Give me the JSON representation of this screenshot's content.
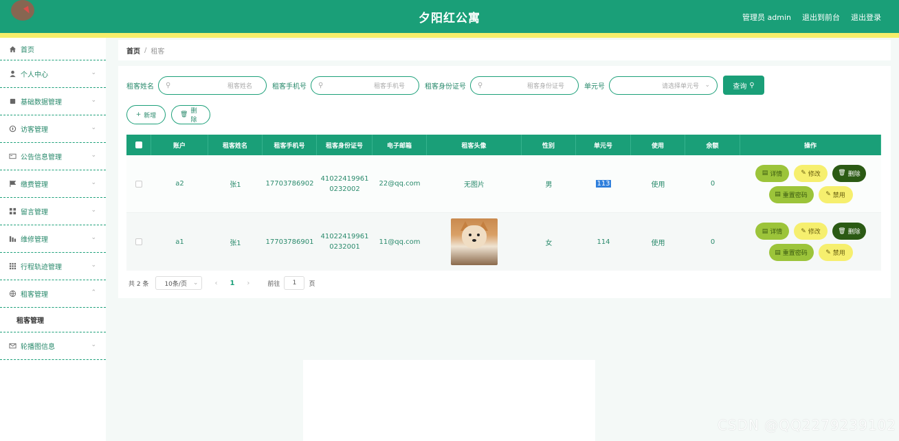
{
  "header": {
    "title": "夕阳红公寓",
    "links": [
      "管理员 admin",
      "退出到前台",
      "退出登录"
    ]
  },
  "sidebar": {
    "items": [
      {
        "label": "首页",
        "icon": "home-icon"
      },
      {
        "label": "个人中心",
        "icon": "user-icon"
      },
      {
        "label": "基础数据管理",
        "icon": "book-icon"
      },
      {
        "label": "访客管理",
        "icon": "compass-icon"
      },
      {
        "label": "公告信息管理",
        "icon": "id-card-icon"
      },
      {
        "label": "缴费管理",
        "icon": "flag-icon"
      },
      {
        "label": "留言管理",
        "icon": "grid-icon"
      },
      {
        "label": "维修管理",
        "icon": "chart-icon"
      },
      {
        "label": "行程轨迹管理",
        "icon": "apps-icon"
      },
      {
        "label": "租客管理",
        "icon": "globe-icon"
      },
      {
        "label": "轮播图信息",
        "icon": "mail-icon"
      }
    ],
    "sub_item": "租客管理"
  },
  "breadcrumb": {
    "home": "首页",
    "sep": "/",
    "current": "租客"
  },
  "search": {
    "name_label": "租客姓名",
    "name_placeholder": "租客姓名",
    "phone_label": "租客手机号",
    "phone_placeholder": "租客手机号",
    "idcard_label": "租客身份证号",
    "idcard_placeholder": "租客身份证号",
    "unit_label": "单元号",
    "unit_placeholder": "请选择单元号",
    "query_button": "查询"
  },
  "actions": {
    "add": "新增",
    "delete": "删除"
  },
  "table": {
    "headers": [
      "账户",
      "租客姓名",
      "租客手机号",
      "租客身份证号",
      "电子邮箱",
      "租客头像",
      "性别",
      "单元号",
      "使用",
      "余额",
      "操作"
    ],
    "rows": [
      {
        "account": "a2",
        "name": "张1",
        "phone": "17703786902",
        "id_line1": "41022419961",
        "id_line2": "0232002",
        "email": "22@qq.com",
        "avatar": "无图片",
        "gender": "男",
        "unit": "113",
        "use": "使用",
        "balance": "0"
      },
      {
        "account": "a1",
        "name": "张1",
        "phone": "17703786901",
        "id_line1": "41022419961",
        "id_line2": "0232001",
        "email": "11@qq.com",
        "avatar": "",
        "gender": "女",
        "unit": "114",
        "use": "使用",
        "balance": "0"
      }
    ],
    "ops": {
      "detail": "详情",
      "edit": "修改",
      "delete": "删除",
      "reset": "重置密码",
      "ban": "禁用"
    }
  },
  "pager": {
    "total": "共 2 条",
    "size": "10条/页",
    "current": "1",
    "goto": "前往",
    "goto_value": "1",
    "page": "页"
  },
  "watermark": "CSDN @QQ2279239102",
  "colors": {
    "primary": "#1a9f78",
    "accent_yellow": "#f6ee6a",
    "op_green": "#9cc43a",
    "op_dark": "#2b5a14"
  }
}
